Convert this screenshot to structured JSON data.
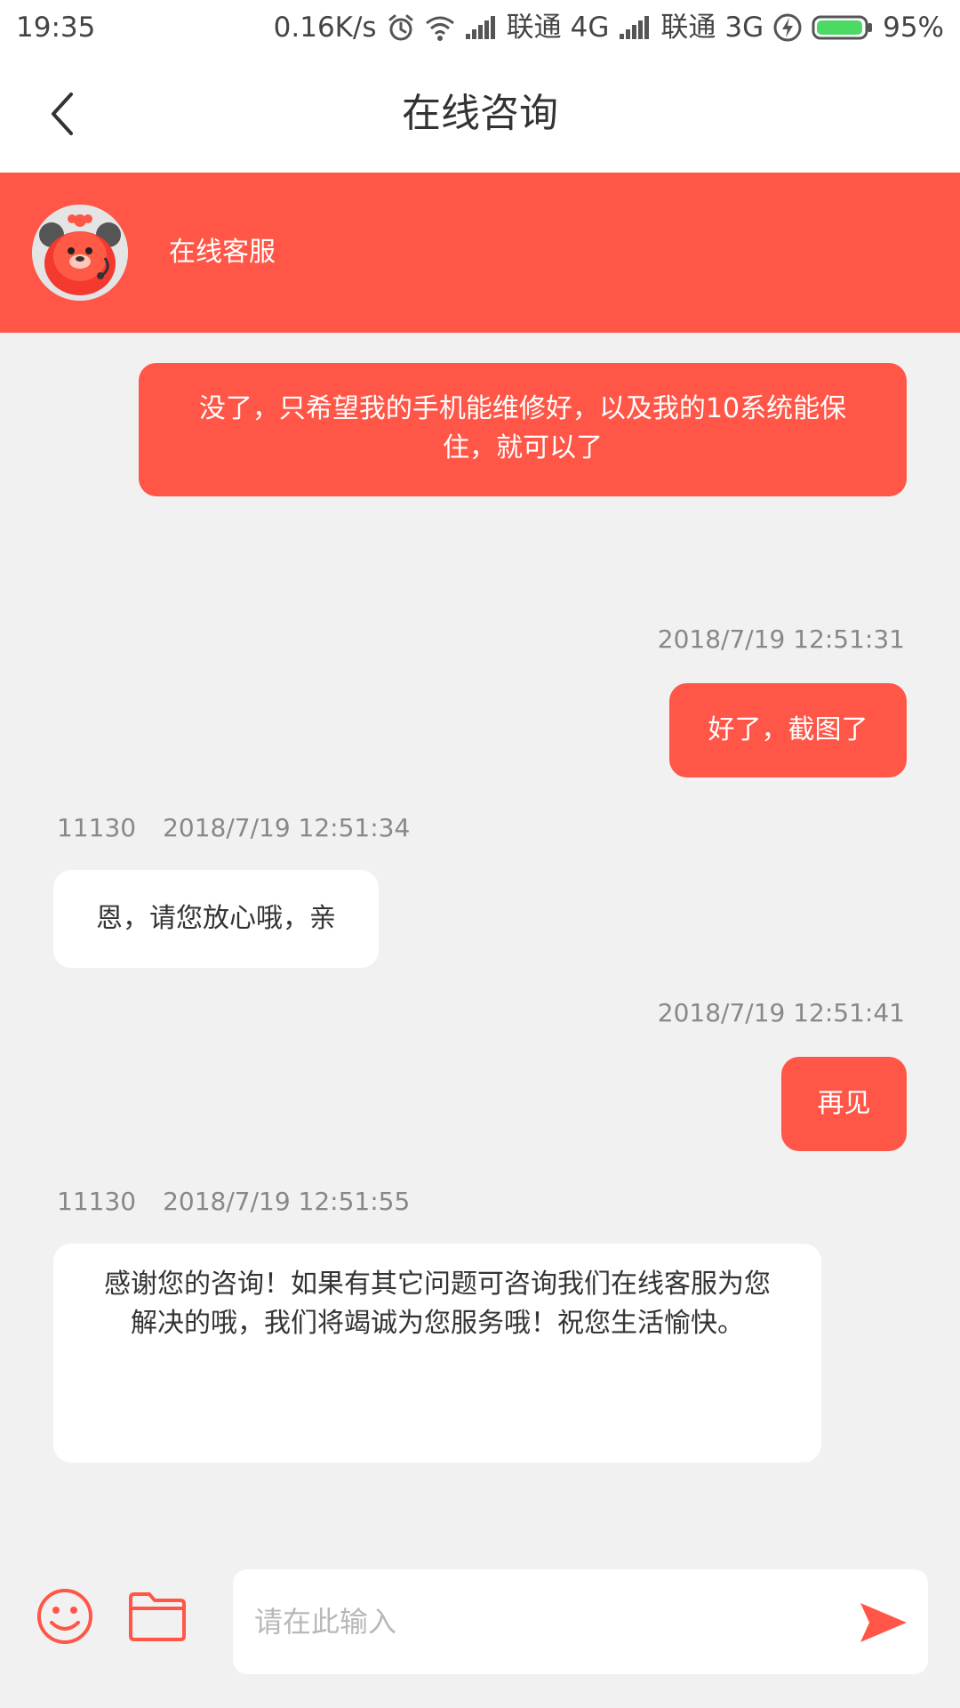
{
  "status_bar": {
    "time": "19:35",
    "speed": "0.16K/s",
    "carrier1": "联通",
    "network1": "4G",
    "carrier2": "联通",
    "network2": "3G",
    "battery": "95%",
    "battery_level": 0.95,
    "icons": [
      "alarm-icon",
      "wifi-icon",
      "signal-icon",
      "charging-icon",
      "battery-icon"
    ]
  },
  "header": {
    "title": "在线咨询",
    "back_icon": "chevron-left-icon"
  },
  "agent": {
    "name": "在线客服",
    "avatar_icon": "bear-mascot-avatar"
  },
  "messages": [
    {
      "direction": "out",
      "text": "没了，只希望我的手机能维修好，以及我的10系统能保住，就可以了"
    },
    {
      "direction": "out",
      "timestamp": "2018/7/19 12:51:31",
      "text": "好了，截图了"
    },
    {
      "direction": "in",
      "sender": "11130",
      "timestamp": "2018/7/19 12:51:34",
      "text": "恩，请您放心哦，亲"
    },
    {
      "direction": "out",
      "timestamp": "2018/7/19 12:51:41",
      "text": "再见"
    },
    {
      "direction": "in",
      "sender": "11130",
      "timestamp": "2018/7/19 12:51:55",
      "text": "感谢您的咨询！如果有其它问题可咨询我们在线客服为您解决的哦，我们将竭诚为您服务哦！祝您生活愉快。"
    }
  ],
  "input_bar": {
    "placeholder": "请在此输入",
    "value": "",
    "icons": [
      "emoji-icon",
      "folder-icon",
      "send-icon"
    ]
  },
  "colors": {
    "accent": "#ff5647",
    "background": "#f1f1f1",
    "incoming_bubble": "#ffffff"
  }
}
